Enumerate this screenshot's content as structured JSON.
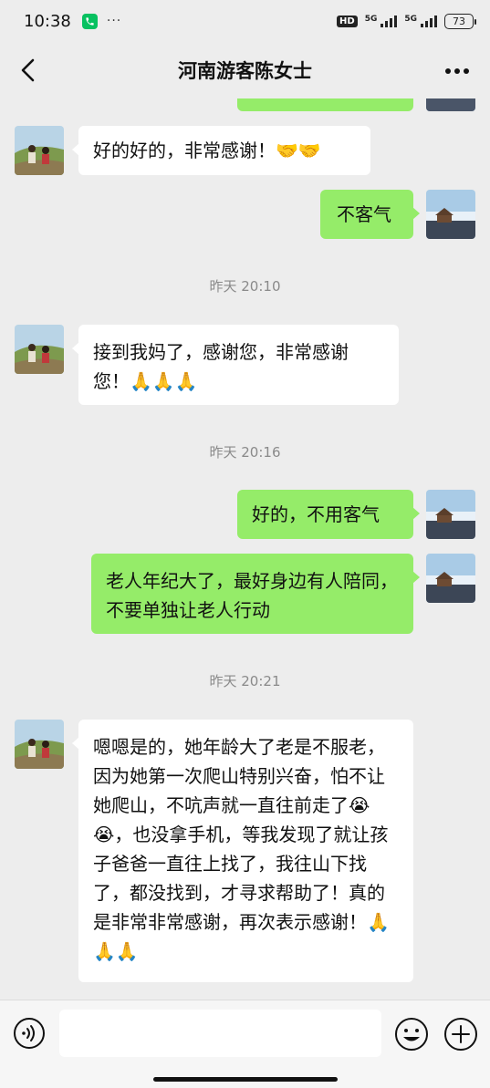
{
  "status_bar": {
    "time": "10:38",
    "dots": "···",
    "hd_badge": "HD",
    "network_1": "5G",
    "network_2": "5G",
    "battery": "73"
  },
  "header": {
    "title": "河南游客陈女士"
  },
  "messages": [
    {
      "side": "in",
      "text": "好的好的，非常感谢！🤝🤝"
    },
    {
      "side": "out",
      "text": "不客气"
    },
    {
      "side": "time",
      "text": "昨天 20:10"
    },
    {
      "side": "in",
      "text": "接到我妈了，感谢您，非常感谢您！🙏🙏🙏"
    },
    {
      "side": "time",
      "text": "昨天 20:16"
    },
    {
      "side": "out",
      "text": "好的，不用客气"
    },
    {
      "side": "out",
      "text": "老人年纪大了，最好身边有人陪同，不要单独让老人行动"
    },
    {
      "side": "time",
      "text": "昨天 20:21"
    },
    {
      "side": "in",
      "text": "嗯嗯是的，她年龄大了老是不服老，因为她第一次爬山特别兴奋，怕不让她爬山，不吭声就一直往前走了😭😭，也没拿手机，等我发现了就让孩子爸爸一直往上找了，我往山下找了，都没找到，才寻求帮助了！真的是非常非常感谢，再次表示感谢！🙏🙏🙏"
    }
  ],
  "input_bar": {
    "placeholder": ""
  },
  "colors": {
    "background": "#ededed",
    "incoming_bubble": "#ffffff",
    "outgoing_bubble": "#95ec69",
    "timestamp_text": "#8a8a8a"
  },
  "icons": {
    "back": "back-arrow-icon",
    "more": "more-dots-icon",
    "voice": "voice-icon",
    "emoji": "emoji-icon",
    "add": "add-icon",
    "call": "phone-icon"
  }
}
